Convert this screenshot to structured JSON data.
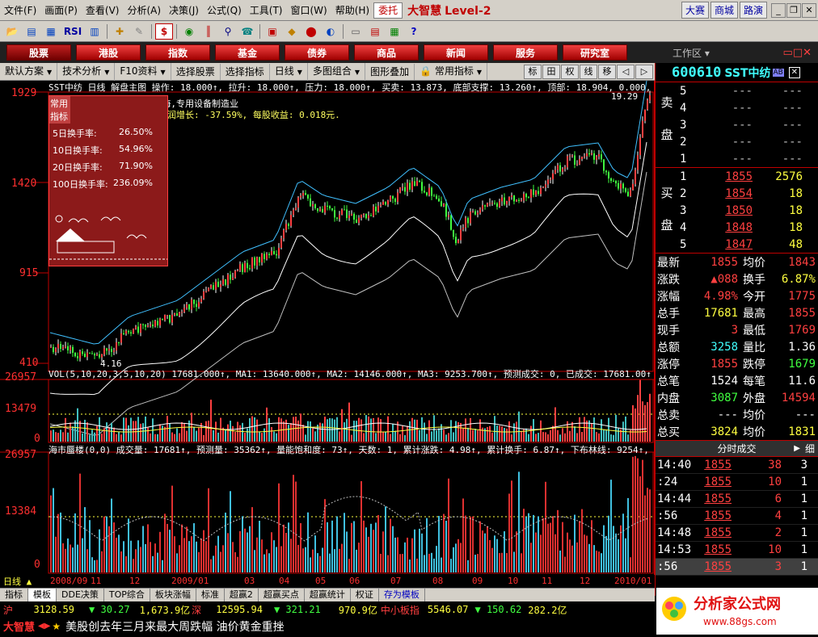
{
  "menubar": {
    "items": [
      "文件(F)",
      "画面(P)",
      "查看(V)",
      "分析(A)",
      "决策(J)",
      "公式(Q)",
      "工具(T)",
      "窗口(W)",
      "帮助(H)",
      "委托"
    ],
    "brand": "大智慧",
    "level": "Level-2",
    "right": [
      "大赛",
      "商城",
      "路演"
    ]
  },
  "toolbar": {
    "rsi": "RSI",
    "dollar": "$"
  },
  "navbar": {
    "buttons": [
      "股票",
      "港股",
      "指数",
      "基金",
      "债券",
      "商品",
      "新闻",
      "服务",
      "研究室"
    ],
    "workarea": "工作区"
  },
  "subbar": {
    "items": [
      "默认方案",
      "技术分析",
      "F10资料",
      "选择股票",
      "选择指标",
      "日线",
      "多图组合",
      "图形叠加",
      "常用指标"
    ],
    "tools": [
      "标",
      "田",
      "权",
      "线",
      "移"
    ]
  },
  "chart": {
    "header": "SST中纺  日线  解盘主图  操作: 18.000↑, 拉升: 18.000↑, 压力: 18.000↑, 买卖: 13.873, 底部支撑: 13.260↑, 顶部: 18.904, 0.000, 0.000",
    "price_axis": [
      "1929",
      "1420",
      "915",
      "410"
    ],
    "high_mark": "19.29",
    "low_mark": "4.16",
    "info_line1": "机械,ST,S板,中价,上海,专用设备制造业",
    "info_line2": "流通盘: 2574万股, 利润增长: -37.59%, 每股收益: 0.018元.",
    "panel_tabs": [
      "常用",
      "指标"
    ],
    "rates": [
      {
        "label": "5日换手率:",
        "value": "26.50%"
      },
      {
        "label": "10日换手率:",
        "value": "54.96%"
      },
      {
        "label": "20日换手率:",
        "value": "71.90%"
      },
      {
        "label": "100日换手率:",
        "value": "236.09%"
      }
    ],
    "vol_header": "VOL(5,10,20,3,5,10,20) 17681.000↑, MA1: 13640.000↑, MA2: 14146.000↑, MA3: 9253.700↑, 预测成交: 0, 已成交: 17681.00↑, 换手率%",
    "vol_axis": [
      "26957",
      "13479",
      "0"
    ],
    "mirage_header": "海市蜃楼(0,0)  成交量: 17681↑, 预测量: 35362↑, 量能饱和度: 73↑, 天数: 1, 累计涨跌: 4.98↑, 累计换手: 6.87↑, 下布林线: 9254↑, 上布",
    "mirage_axis": [
      "26957",
      "13384",
      "0"
    ],
    "dates": [
      "2008/09",
      "11",
      "12",
      "2009/01",
      "03",
      "04",
      "05",
      "06",
      "07",
      "08",
      "09",
      "10",
      "11",
      "12",
      "2010/01"
    ],
    "period": "日线"
  },
  "tabs": [
    "指标",
    "模板",
    "DDE决策",
    "TOP综合",
    "板块涨幅",
    "标准",
    "超赢2",
    "超赢买点",
    "超赢统计",
    "权证",
    "存为模板"
  ],
  "indexbar": {
    "sh_label": "沪",
    "sh_val": "3128.59",
    "sh_chg": "▼ 30.27",
    "sh_amt": "1,673.9亿",
    "sz_label": "深",
    "sz_val": "12595.94",
    "sz_chg": "▼ 321.21",
    "sz_amt": "970.9亿",
    "zx_label": "中小板指",
    "zx_val": "5546.07",
    "zx_chg": "▼ 150.62",
    "zx_amt": "282.2亿"
  },
  "news": {
    "brand": "大智慧",
    "text": "美股创去年三月来最大周跌幅 油价黄金重挫"
  },
  "quote": {
    "code": "600610",
    "name": "SST中纺",
    "sell_label": [
      "卖",
      "盘"
    ],
    "buy_label": [
      "买",
      "盘"
    ],
    "sell": [
      {
        "lv": "5",
        "p": "---",
        "v": "---"
      },
      {
        "lv": "4",
        "p": "---",
        "v": "---"
      },
      {
        "lv": "3",
        "p": "---",
        "v": "---"
      },
      {
        "lv": "2",
        "p": "---",
        "v": "---"
      },
      {
        "lv": "1",
        "p": "---",
        "v": "---"
      }
    ],
    "buy": [
      {
        "lv": "1",
        "p": "1855",
        "v": "2576"
      },
      {
        "lv": "2",
        "p": "1854",
        "v": "18"
      },
      {
        "lv": "3",
        "p": "1850",
        "v": "18"
      },
      {
        "lv": "4",
        "p": "1848",
        "v": "18"
      },
      {
        "lv": "5",
        "p": "1847",
        "v": "48"
      }
    ],
    "stats": [
      {
        "k": "最新",
        "v": "1855",
        "vc": "red",
        "k2": "均价",
        "v2": "1843",
        "v2c": "red"
      },
      {
        "k": "涨跌",
        "v": "▲088",
        "vc": "red",
        "k2": "换手",
        "v2": "6.87%",
        "v2c": "yellow"
      },
      {
        "k": "涨幅",
        "v": "4.98%",
        "vc": "red",
        "k2": "今开",
        "v2": "1775",
        "v2c": "red"
      },
      {
        "k": "总手",
        "v": "17681",
        "vc": "yellow",
        "k2": "最高",
        "v2": "1855",
        "v2c": "red"
      },
      {
        "k": "现手",
        "v": "3",
        "vc": "red",
        "k2": "最低",
        "v2": "1769",
        "v2c": "red"
      },
      {
        "k": "总额",
        "v": "3258",
        "vc": "cyan",
        "k2": "量比",
        "v2": "1.36",
        "v2c": "white"
      },
      {
        "k": "涨停",
        "v": "1855",
        "vc": "red",
        "k2": "跌停",
        "v2": "1679",
        "v2c": "green"
      },
      {
        "k": "总笔",
        "v": "1524",
        "vc": "white",
        "k2": "每笔",
        "v2": "11.6",
        "v2c": "white"
      },
      {
        "k": "内盘",
        "v": "3087",
        "vc": "green",
        "k2": "外盘",
        "v2": "14594",
        "v2c": "red"
      },
      {
        "k": "总卖",
        "v": "---",
        "vc": "white",
        "k2": "均价",
        "v2": "---",
        "v2c": "white"
      },
      {
        "k": "总买",
        "v": "3824",
        "vc": "yellow",
        "k2": "均价",
        "v2": "1831",
        "v2c": "yellow"
      }
    ],
    "tick_header": "分时成交",
    "tick_detail": "细",
    "ticks": [
      {
        "t": "14:40",
        "p": "1855",
        "q": "38",
        "n": "3"
      },
      {
        "t": ":24",
        "p": "1855",
        "q": "10",
        "n": "1"
      },
      {
        "t": "14:44",
        "p": "1855",
        "q": "6",
        "n": "1"
      },
      {
        "t": ":56",
        "p": "1855",
        "q": "4",
        "n": "1"
      },
      {
        "t": "14:48",
        "p": "1855",
        "q": "2",
        "n": "1"
      },
      {
        "t": "14:53",
        "p": "1855",
        "q": "10",
        "n": "1"
      },
      {
        "t": ":56",
        "p": "1855",
        "q": "3",
        "n": "1"
      }
    ]
  },
  "logo": {
    "title": "分析家公式网",
    "url": "www.88gs.com"
  },
  "colors": {
    "up": "#ff4040",
    "down": "#40ff40",
    "axis": "#c00000",
    "bg": "#000000"
  }
}
